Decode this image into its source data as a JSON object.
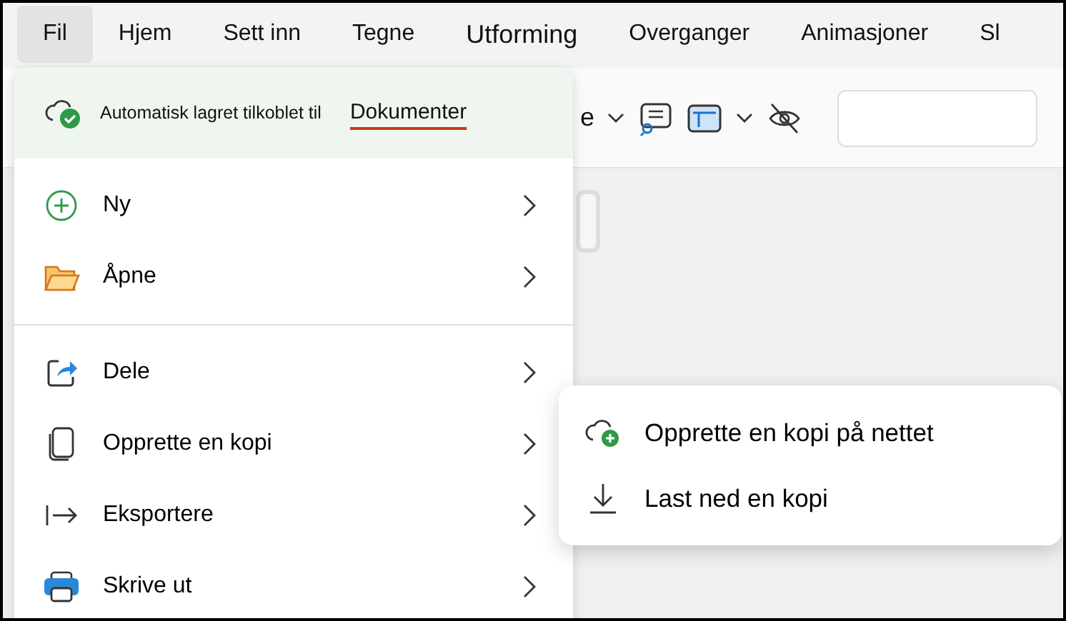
{
  "tabs": [
    {
      "label": "Fil",
      "selected": true
    },
    {
      "label": "Hjem",
      "selected": false
    },
    {
      "label": "Sett inn",
      "selected": false
    },
    {
      "label": "Tegne",
      "selected": false
    },
    {
      "label": "Utforming",
      "selected": false
    },
    {
      "label": "Overganger",
      "selected": false
    },
    {
      "label": "Animasjoner",
      "selected": false
    },
    {
      "label": "Sl",
      "selected": false
    }
  ],
  "ribbon": {
    "partial_label": "e"
  },
  "file_menu": {
    "autosave": {
      "text": "Automatisk lagret tilkoblet til",
      "location": "Dokumenter"
    },
    "groups": [
      [
        {
          "kind": "new",
          "label": "Ny"
        },
        {
          "kind": "open",
          "label": "Åpne"
        }
      ],
      [
        {
          "kind": "share",
          "label": "Dele"
        },
        {
          "kind": "copy",
          "label": "Opprette en kopi"
        },
        {
          "kind": "export",
          "label": "Eksportere"
        },
        {
          "kind": "print",
          "label": "Skrive ut"
        }
      ]
    ]
  },
  "submenu": {
    "items": [
      {
        "kind": "cloud-add",
        "label": "Opprette en kopi på nettet"
      },
      {
        "kind": "download",
        "label": "Last ned en kopi"
      }
    ]
  }
}
